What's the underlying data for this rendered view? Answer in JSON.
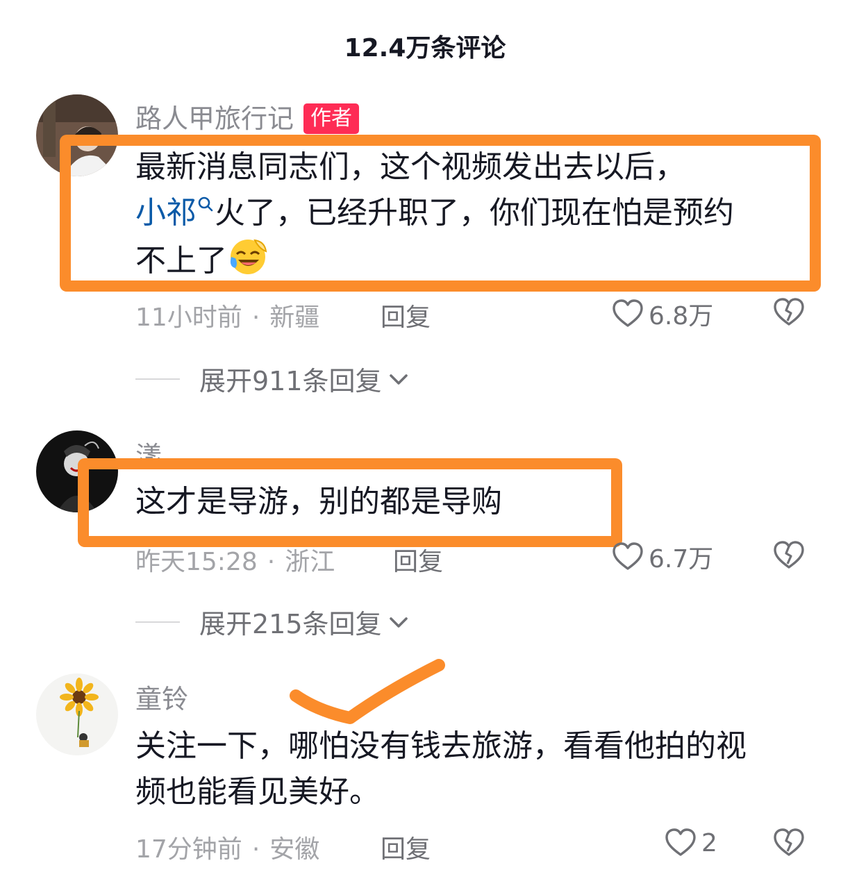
{
  "header": {
    "title": "12.4万条评论"
  },
  "comments": [
    {
      "username": "路人甲旅行记",
      "badge": "作者",
      "line1": "最新消息同志们，这个视频发出去以后，",
      "mention": "小祁",
      "line2_rest": "火了，已经升职了，你们现在怕是预约",
      "line3": "不上了",
      "time": "11小时前",
      "location": "新疆",
      "reply_label": "回复",
      "likes": "6.8万",
      "expand_label": "展开911条回复"
    },
    {
      "username": "漾",
      "text": "这才是导游，别的都是导购",
      "time": "昨天15:28",
      "location": "浙江",
      "reply_label": "回复",
      "likes": "6.7万",
      "expand_label": "展开215条回复"
    },
    {
      "username": "童铃",
      "line1": "关注一下，哪怕没有钱去旅游，看看他拍的视",
      "line2": "频也能看见美好。",
      "time": "17分钟前",
      "location": "安徽",
      "reply_label": "回复",
      "likes": "2"
    }
  ],
  "icons": {
    "like": "heart-outline-icon",
    "dislike": "broken-heart-icon",
    "expand": "chevron-down-icon",
    "mention": "search-icon",
    "emoji": "laughing-crying-emoji"
  },
  "colors": {
    "annotation": "#fb8c2b",
    "author_badge": "#fe2c55",
    "mention": "#0a5aa8"
  }
}
